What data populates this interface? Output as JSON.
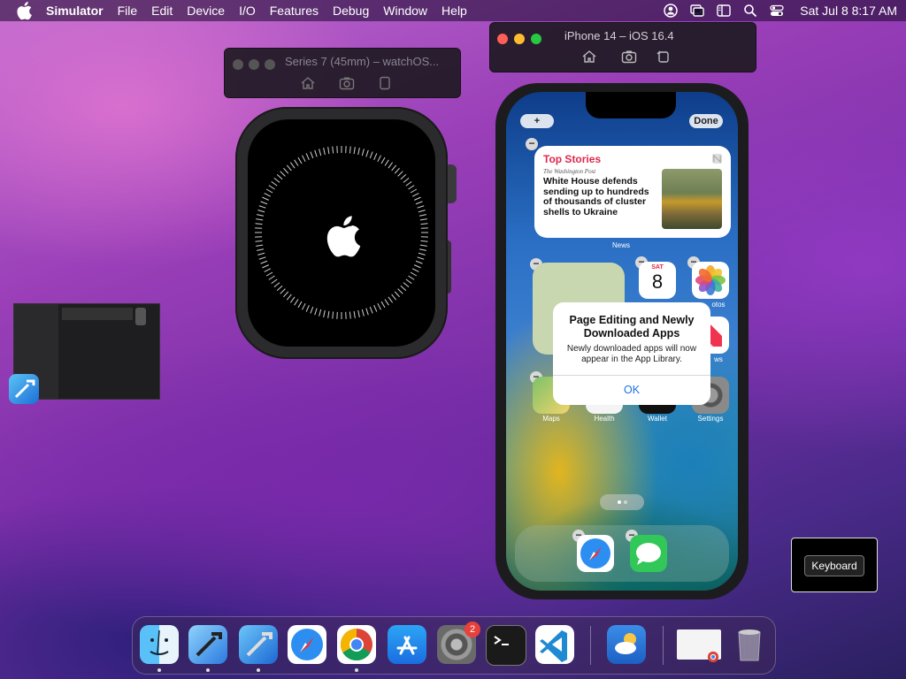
{
  "menubar": {
    "app_name": "Simulator",
    "items": [
      "File",
      "Edit",
      "Device",
      "I/O",
      "Features",
      "Debug",
      "Window",
      "Help"
    ],
    "clock": "Sat Jul 8  8:17 AM"
  },
  "watch_window": {
    "title": "Series 7 (45mm) – watchOS..."
  },
  "phone_window": {
    "title": "iPhone 14 – iOS 16.4"
  },
  "phone": {
    "add_button": "+",
    "done_button": "Done",
    "widget": {
      "heading": "Top Stories",
      "source": "The Washington Post",
      "headline": "White House defends sending up to hundreds of thousands of cluster shells to Ukraine",
      "caption": "News"
    },
    "calendar": {
      "weekday": "SAT",
      "day": "8"
    },
    "apps": {
      "photos": "otos",
      "news": "ws",
      "maps": "Maps",
      "health": "Health",
      "wallet": "Wallet",
      "settings": "Settings"
    },
    "alert": {
      "title": "Page Editing and Newly Downloaded Apps",
      "message": "Newly downloaded apps will now appear in the App Library.",
      "button": "OK"
    }
  },
  "keyboard_window": {
    "button": "Keyboard"
  },
  "dock": {
    "settings_badge": "2"
  },
  "colors": {
    "accent_blue": "#1a72e8",
    "badge_red": "#e8403a",
    "headline_red": "#e0264b"
  }
}
